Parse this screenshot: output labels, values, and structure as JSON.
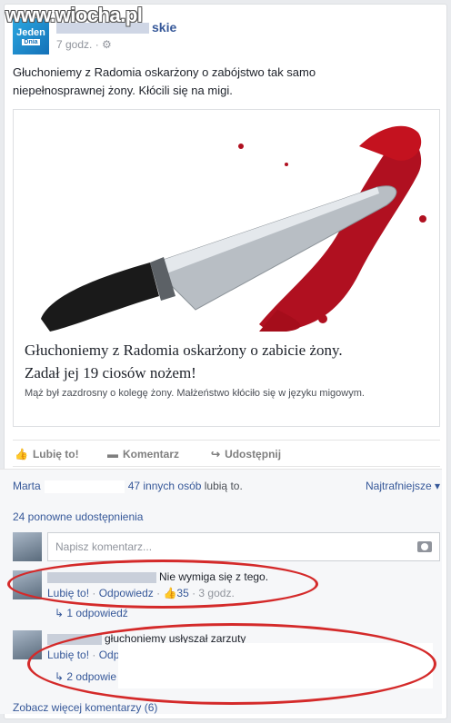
{
  "watermark": "www.wiocha.pl",
  "post": {
    "page_logo_text": "Jeden",
    "page_logo_badge": "Dnia",
    "page_name_tail": "skie",
    "time": "7 godz. · ",
    "text_line1": "Głuchoniemy z Radomia oskarżony o zabójstwo tak samo",
    "text_line2": "niepełnosprawnej żony. Kłócili się na migi."
  },
  "link": {
    "title_line1": "Głuchoniemy z Radomia oskarżony o zabicie żony.",
    "title_line2": "Zadał jej 19 ciosów nożem!",
    "description": "Mąż był zazdrosny o kolegę żony. Małżeństwo kłóciło się w języku migowym."
  },
  "actions": {
    "like": "Lubię to!",
    "comment": "Komentarz",
    "share": "Udostępnij"
  },
  "summary": {
    "liker": "Marta",
    "others": "47 innych osób",
    "likes_suffix": " lubią to.",
    "sort": "Najtrafniejsze ▾",
    "shares": "24 ponowne udostępnienia"
  },
  "compose": {
    "placeholder": "Napisz komentarz..."
  },
  "comments": [
    {
      "text": "Nie wymiga się z tego.",
      "like": "Lubię to!",
      "reply": "Odpowiedz",
      "likes": "35",
      "time": "3 godz.",
      "replies": "1 odpowiedź"
    },
    {
      "text": "głuchoniemy usłyszał zarzuty",
      "like": "Lubię to!",
      "reply": "Odp",
      "replies": "2 odpowie"
    }
  ],
  "more_comments": "Zobacz więcej komentarzy (6)",
  "colors": {
    "link_blue": "#365899",
    "annotation_red": "#d42a2a",
    "blood": "#b01020"
  }
}
